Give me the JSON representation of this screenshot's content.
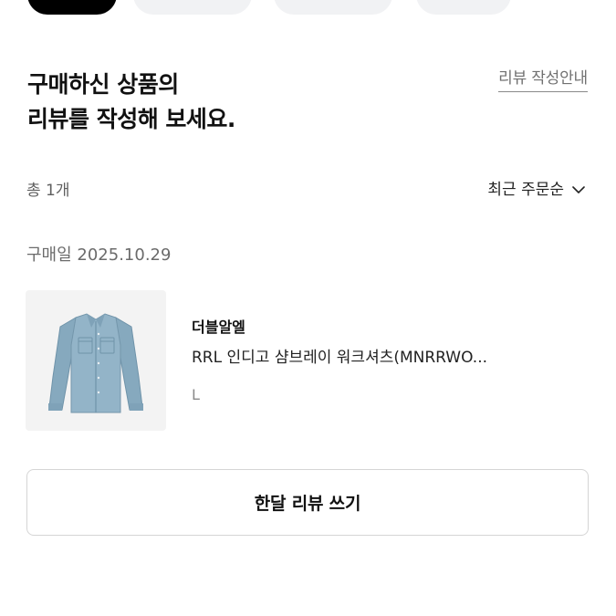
{
  "tabs": [
    {
      "label": "",
      "active": true
    },
    {
      "label": "",
      "active": false
    },
    {
      "label": "",
      "active": false
    },
    {
      "label": "",
      "active": false
    }
  ],
  "header": {
    "title_line1": "구매하신 상품의",
    "title_line2": "리뷰를 작성해 보세요.",
    "guide_link": "리뷰 작성안내"
  },
  "list": {
    "count_label": "총 1개",
    "sort_label": "최근 주문순",
    "sort_icon": "chevron-down-icon"
  },
  "order": {
    "purchase_date": "구매일 2025.10.29",
    "product": {
      "brand": "더블알엘",
      "name": "RRL 인디고 샴브레이 워크셔츠(MNRRWO...",
      "option": "L",
      "image_icon": "shirt-image"
    }
  },
  "actions": {
    "write_review": "한달 리뷰 쓰기"
  },
  "colors": {
    "accent": "#000000",
    "chip_inactive": "#f1f2f4",
    "text_primary": "#111111",
    "text_secondary": "#707070",
    "border": "#d5d5d5",
    "shirt": "#8fb0c4"
  }
}
